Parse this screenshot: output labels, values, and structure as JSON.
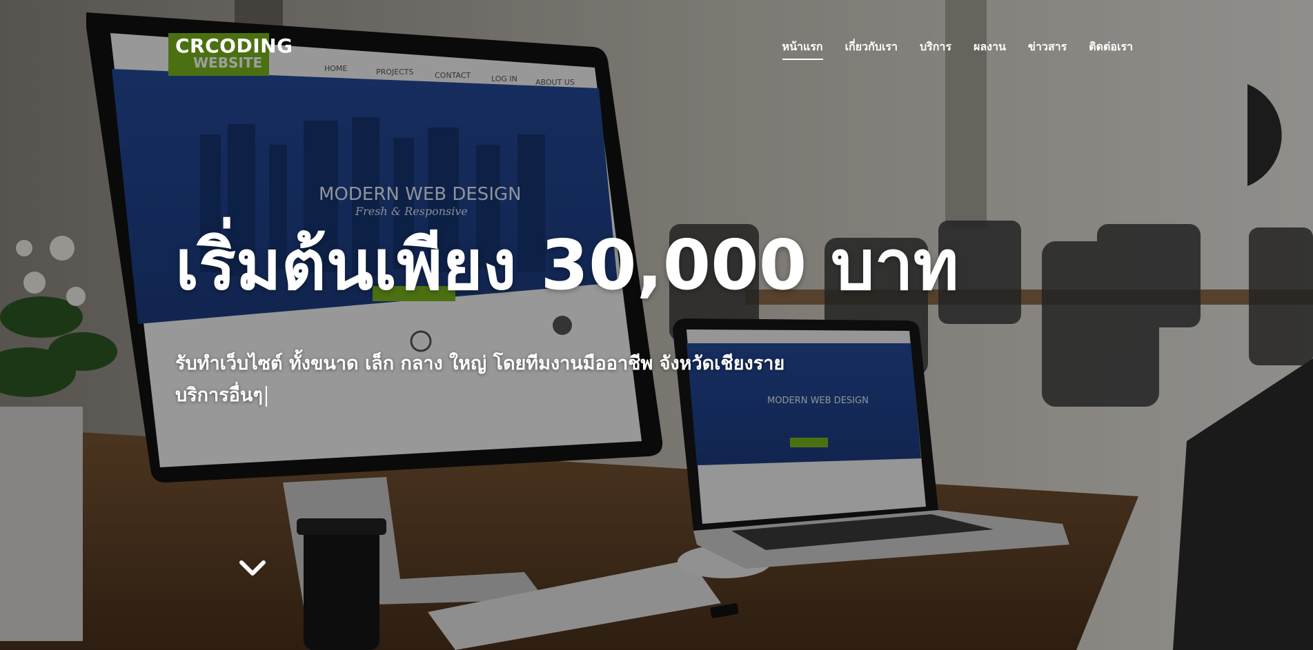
{
  "brand": {
    "logo_text": "CRCODING"
  },
  "nav": {
    "items": [
      {
        "label": "หน้าแรก",
        "active": true
      },
      {
        "label": "เกี่ยวกับเรา",
        "active": false
      },
      {
        "label": "บริการ",
        "active": false
      },
      {
        "label": "ผลงาน",
        "active": false
      },
      {
        "label": "ข่าวสาร",
        "active": false
      },
      {
        "label": "ติดต่อเรา",
        "active": false
      }
    ]
  },
  "hero": {
    "headline": "เริ่มต้นเพียง 30,000 บาท",
    "subline_1": "รับทำเว็บไซต์ ทั้งขนาด เล็ก กลาง ใหญ่ โดยทีมงานมืออาชีพ จังหวัดเชียงราย",
    "subline_2": "บริการอื่นๆ",
    "scroll_icon": "chevron-down-icon"
  },
  "mockup": {
    "monitor_logo": "WEBSITE",
    "monitor_nav": [
      "HOME",
      "PROJECTS",
      "CONTACT",
      "LOG IN",
      "ABOUT US"
    ],
    "screen_title": "MODERN WEB DESIGN",
    "screen_subtitle": "Fresh & Responsive"
  },
  "colors": {
    "overlay": "rgba(0,0,0,0.38)",
    "text": "#ffffff",
    "screen_blue": "#2a4fa0",
    "accent_green": "#7ab51d"
  }
}
